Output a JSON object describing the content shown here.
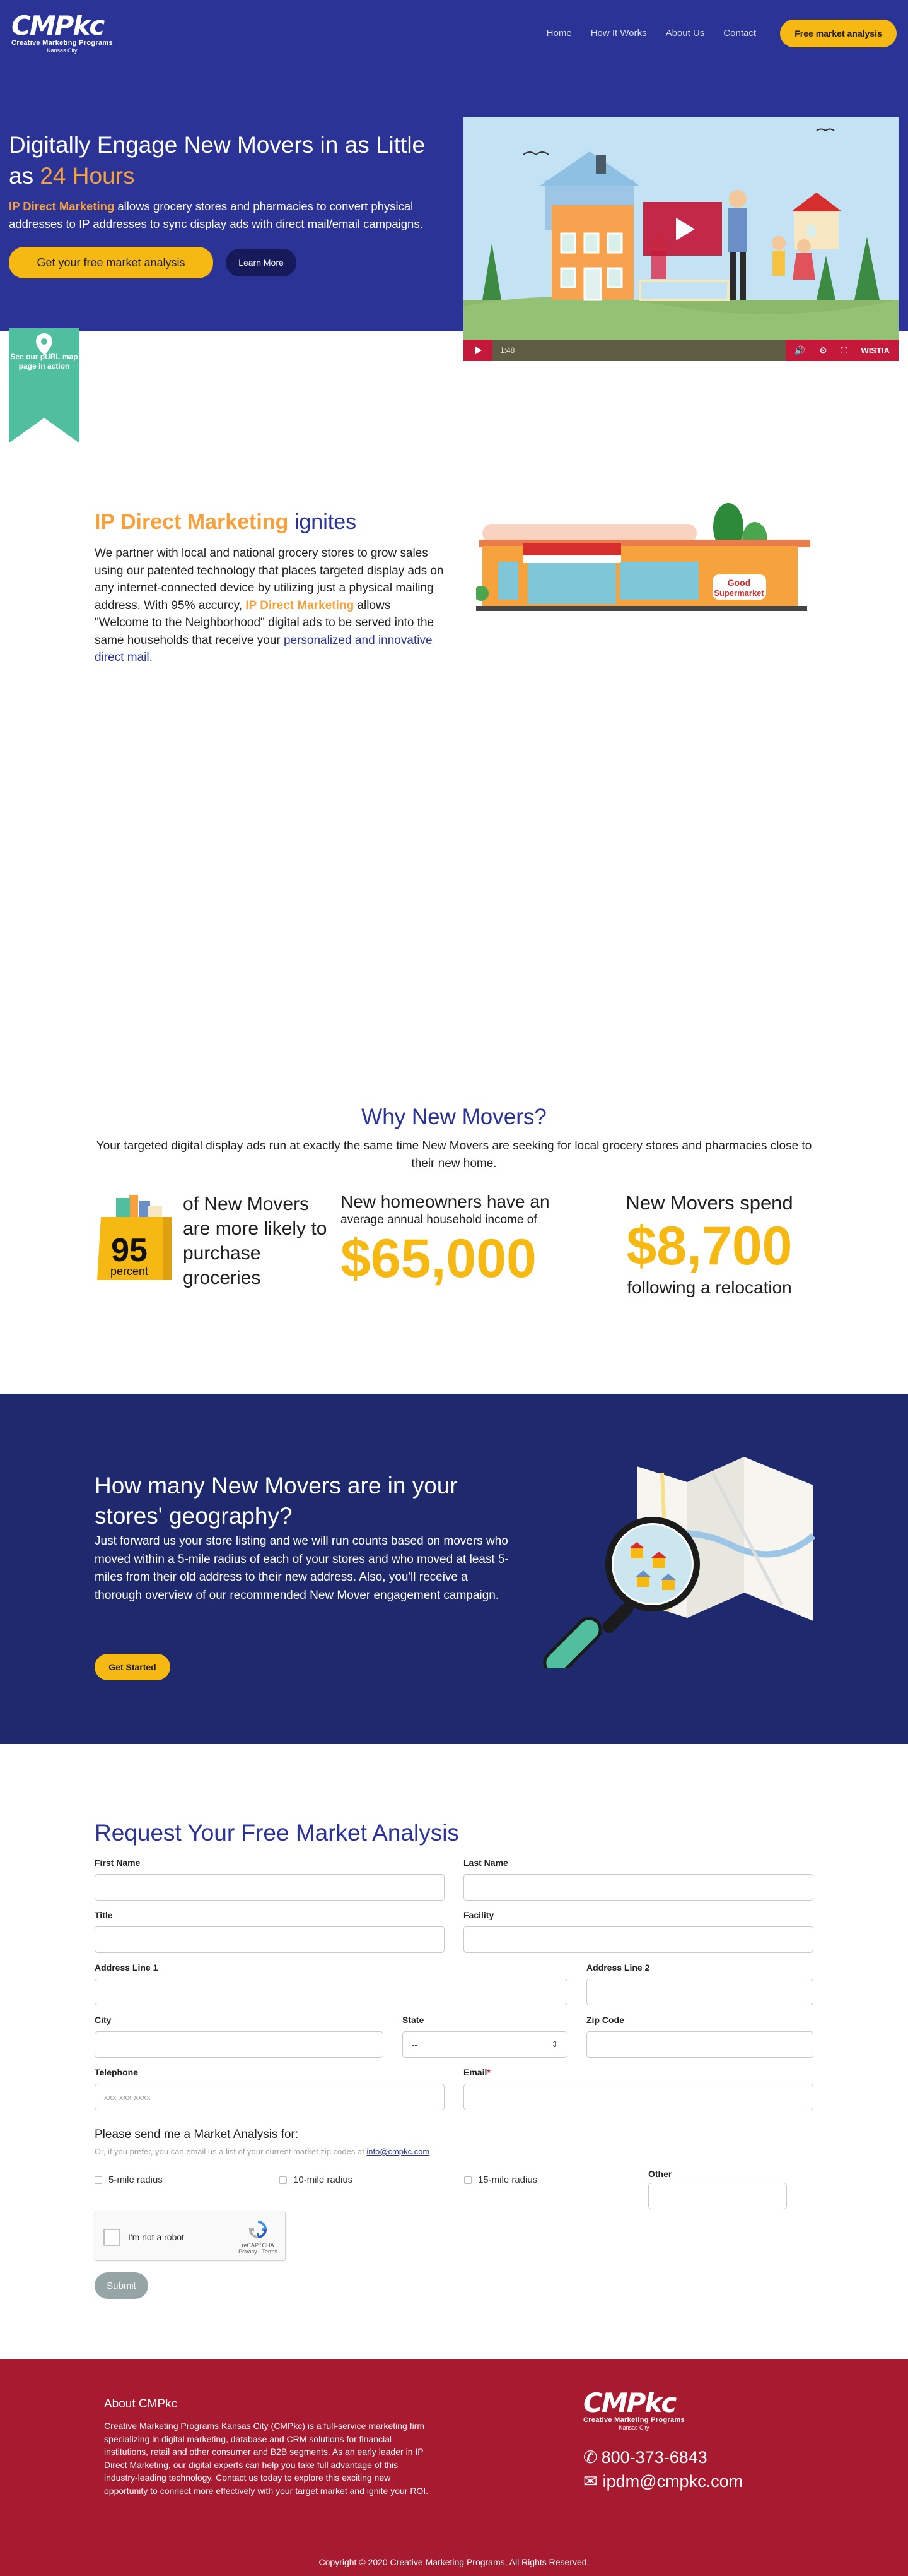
{
  "header": {
    "logo_mark": "CMPkc",
    "logo_sub": "Creative Marketing Programs",
    "logo_city": "Kansas City",
    "nav": [
      "Home",
      "How It Works",
      "About Us",
      "Contact"
    ],
    "cta": "Free market analysis"
  },
  "hero": {
    "title_pre": "Digitally Engage New Movers in as Little as ",
    "title_accent": "24 Hours",
    "body_accent": "IP Direct Marketing",
    "body_rest": " allows grocery stores and pharmacies to convert physical addresses to IP addresses to sync display ads with direct mail/email campaigns.",
    "btn_primary": "Get your free market analysis",
    "btn_secondary": "Learn More",
    "ribbon": "See our pURL map page in action"
  },
  "video": {
    "time": "1:48",
    "brand": "WISTIA"
  },
  "ignites": {
    "title_accent": "IP Direct Marketing",
    "title_rest": " ignites",
    "p_pre": "We partner with local and national grocery stores to grow sales using our patented technology that places targeted display ads on any internet-connected device by utilizing just a physical mailing address. With 95% accurcy, ",
    "p_accent": "IP Direct Marketing",
    "p_mid": " allows \"Welcome to the Neighborhood\" digital ads to be served into the same households that receive your ",
    "p_link": "personalized and innovative direct mail",
    "p_end": ".",
    "store_sign_1": "Good",
    "store_sign_2": "Supermarket"
  },
  "why": {
    "title": "Why New Movers?",
    "lead": "Your targeted digital display ads run at exactly the same time New Movers are seeking for local grocery stores and pharmacies close to their new home.",
    "stat1_num": "95",
    "stat1_unit": "percent",
    "stat1_text": "of New Movers are more likely to purchase groceries",
    "stat2_t1": "New homeowners have an",
    "stat2_t2": "average annual household income of",
    "stat2_big": "$65,000",
    "stat3_t1": "New Movers spend",
    "stat3_big": "$8,700",
    "stat3_t2": "following a relocation"
  },
  "geo": {
    "title": "How many New Movers are in your stores' geography?",
    "body": "Just forward us your store listing and we will run counts based on movers who moved within a 5-mile radius of each of your stores and who moved at least 5-miles from their old address to their new address. Also, you'll receive a thorough overview of our recommended New Mover engagement campaign.",
    "button": "Get Started"
  },
  "form": {
    "title": "Request Your Free Market Analysis",
    "first_name": "First Name",
    "last_name": "Last Name",
    "title_field": "Title",
    "facility": "Facility",
    "address1": "Address Line 1",
    "address2": "Address Line 2",
    "city": "City",
    "state": "State",
    "state_value": "--",
    "zip": "Zip Code",
    "telephone": "Telephone",
    "telephone_placeholder": "xxx-xxx-xxxx",
    "email": "Email",
    "email_required": "*",
    "send_for": "Please send me a Market Analysis for:",
    "hint_pre": "Or, if you prefer, you can email us a list of your current market zip codes at ",
    "hint_link": "info@cmpkc.com",
    "radius_5": "5-mile radius",
    "radius_10": "10-mile radius",
    "radius_15": "15-mile radius",
    "other": "Other",
    "captcha_label": "I'm not a robot",
    "captcha_brand": "reCAPTCHA",
    "captcha_links": "Privacy - Terms",
    "submit": "Submit"
  },
  "footer": {
    "about_title": "About CMPkc",
    "about_body": "Creative Marketing Programs Kansas City (CMPkc) is a full-service marketing firm specializing in digital marketing, database and CRM solutions for financial institutions, retail and other consumer and B2B segments. As an early leader in IP Direct Marketing, our digital experts can help you take full advantage of this industry-leading technology. Contact us today to explore this exciting new opportunity to connect more effectively with your target market and ignite your ROI.",
    "phone": "800-373-6843",
    "email": "ipdm@cmpkc.com",
    "copyright": "Copyright © 2020 Creative Marketing Programs, All Rights Reserved."
  },
  "colors": {
    "hero_blue": "#2b3496",
    "navy": "#1f2a6e",
    "yellow": "#f6b812",
    "orange": "#f6a13b",
    "teal": "#4fbf9f",
    "footer_red": "#a81a30",
    "wistia_red": "#c4193a"
  }
}
